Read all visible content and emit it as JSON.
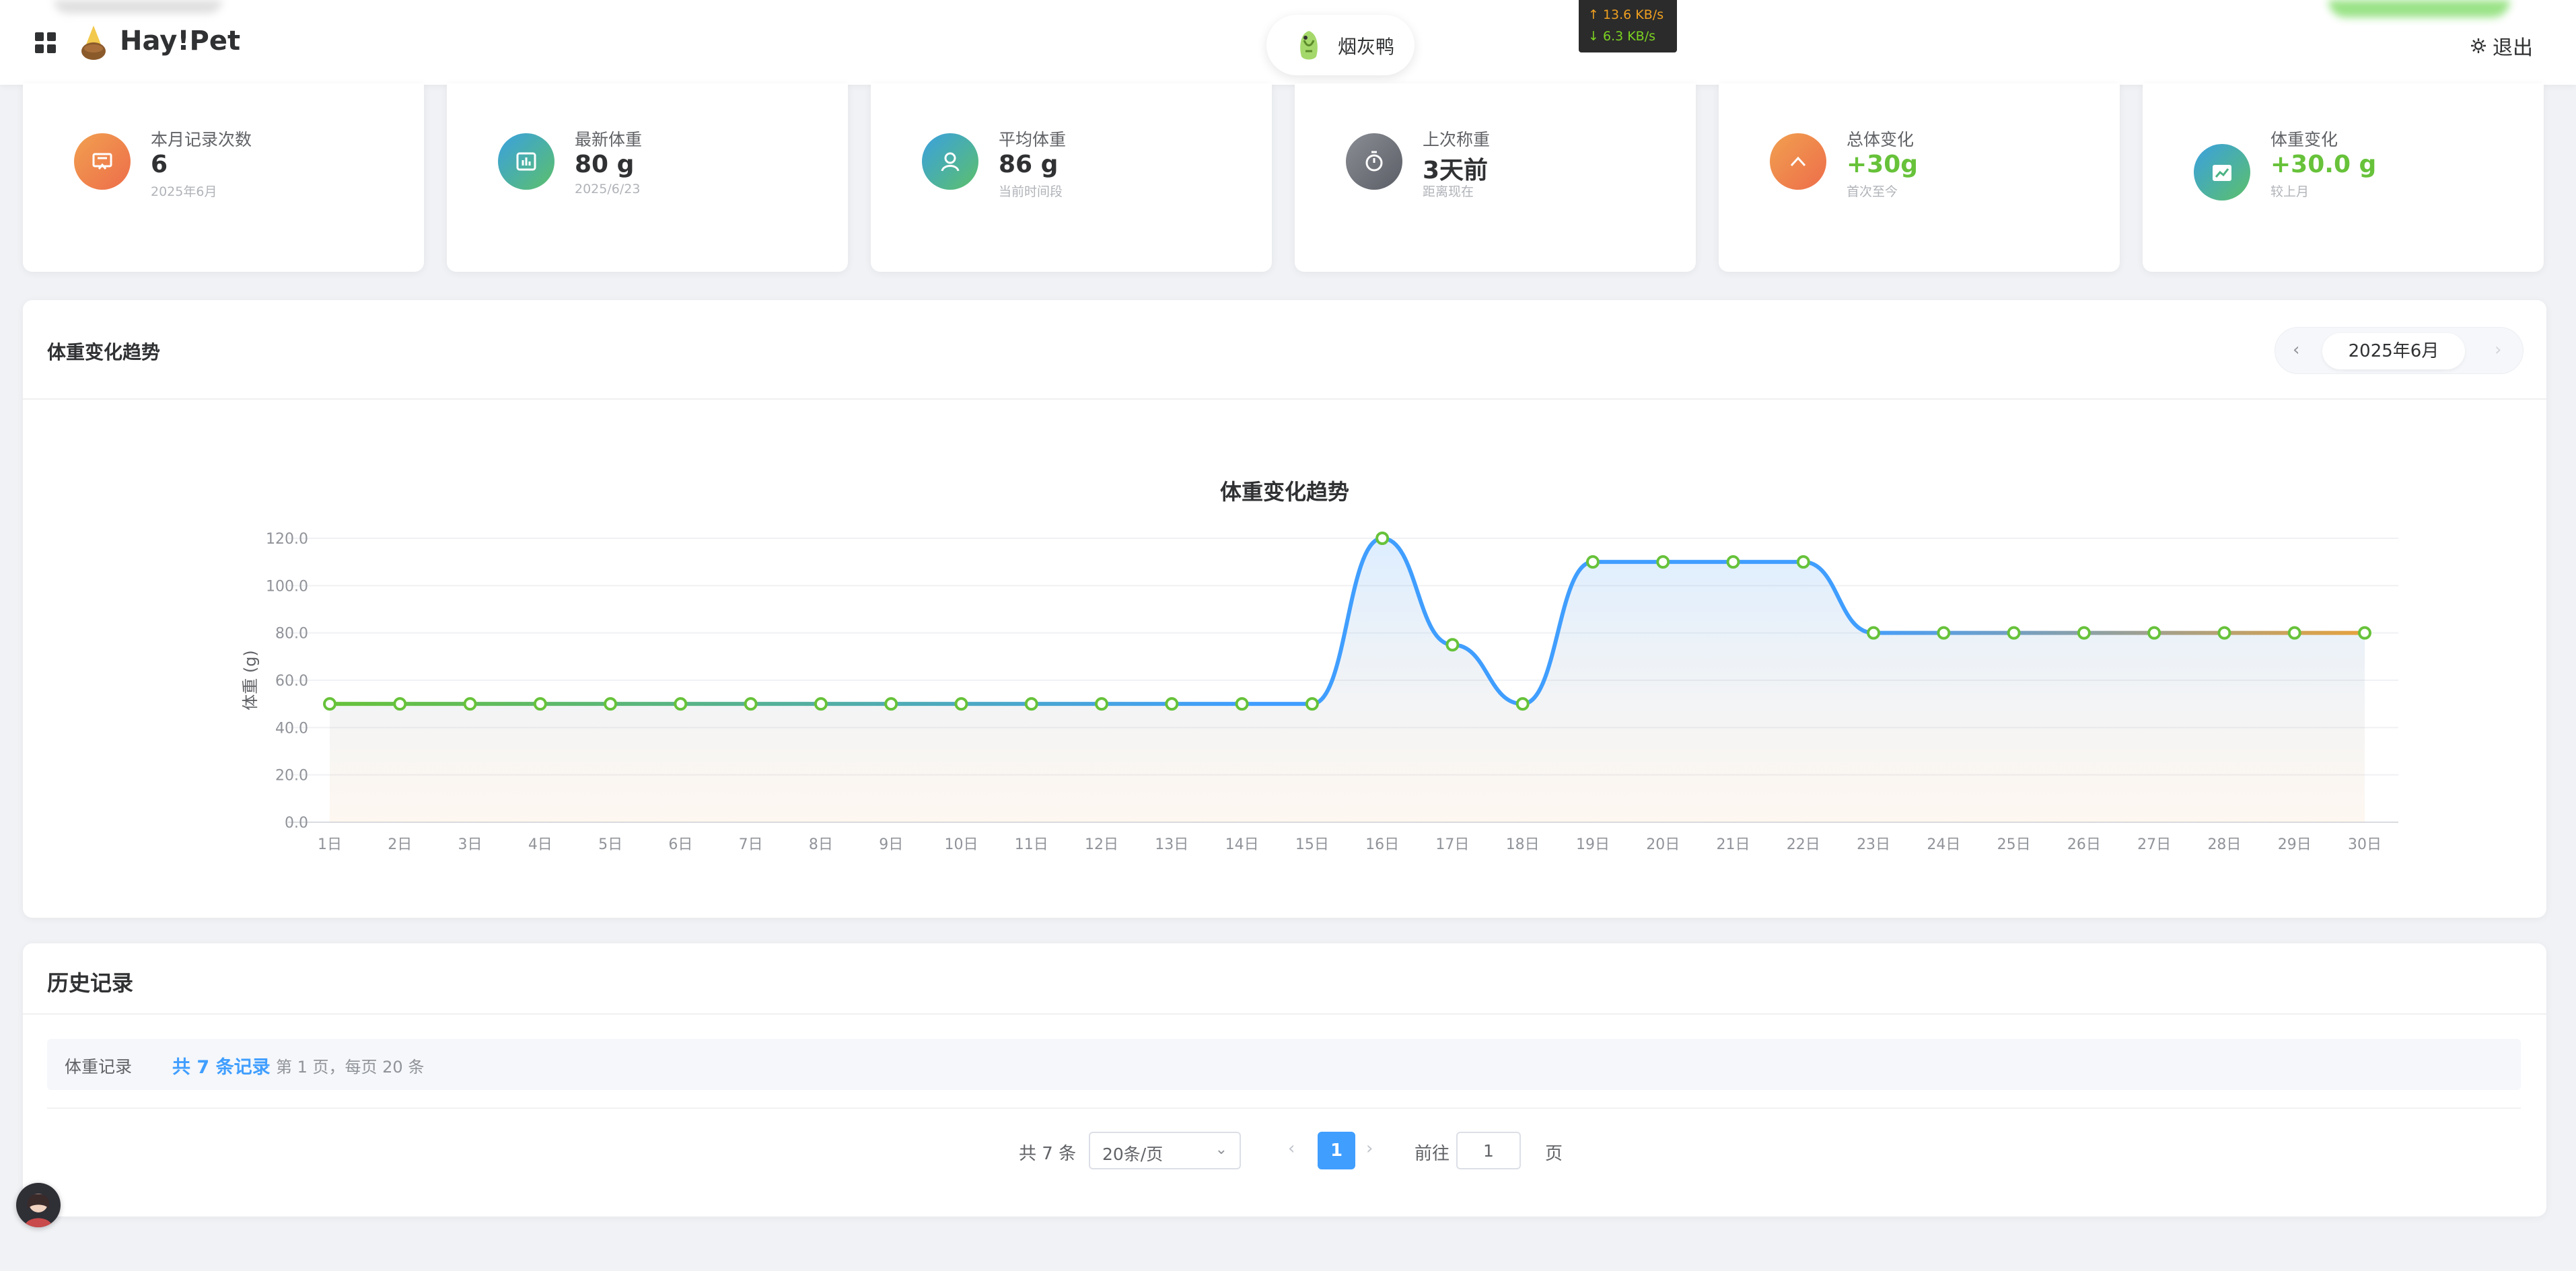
{
  "header": {
    "brand": "Hay!Pet",
    "pet_name": "烟灰鸭",
    "logout_label": "退出",
    "net_up": "↑ 13.6 KB/s",
    "net_down": "↓ 6.3 KB/s"
  },
  "stats": [
    {
      "label": "本月记录次数",
      "value": "6",
      "sub": "2025年6月",
      "icon": "presentation-icon",
      "color_from": "#f0a050",
      "color_to": "#ee6d4a"
    },
    {
      "label": "最新体重",
      "value": "80 g",
      "sub": "2025/6/23",
      "icon": "bar-chart-icon",
      "color_from": "#3aa0e0",
      "color_to": "#5cc06a"
    },
    {
      "label": "平均体重",
      "value": "86 g",
      "sub": "当前时间段",
      "icon": "user-icon",
      "color_from": "#3aa0e0",
      "color_to": "#5cc06a"
    },
    {
      "label": "上次称重",
      "value": "3天前",
      "sub": "距离现在",
      "icon": "stopwatch-icon",
      "color_from": "#8a8d94",
      "color_to": "#5b5e66"
    },
    {
      "label": "总体变化",
      "value": "+30g",
      "sub": "首次至今",
      "icon": "arrow-up-icon",
      "color_from": "#f0a050",
      "color_to": "#ee6d4a"
    },
    {
      "label": "体重变化",
      "value": "+30.0 g",
      "sub": "较上月",
      "icon": "trend-chart-icon",
      "color_from": "#3aa0e0",
      "color_to": "#5cc06a"
    }
  ],
  "chart_panel": {
    "title": "体重变化趋势",
    "month_label": "2025年6月",
    "prev_label": "‹",
    "next_label": "›"
  },
  "chart_data": {
    "type": "line",
    "title": "体重变化趋势",
    "xlabel": "",
    "ylabel": "体重 (g)",
    "ylim": [
      0,
      120
    ],
    "yticks": [
      "0.0",
      "20.0",
      "40.0",
      "60.0",
      "80.0",
      "100.0",
      "120.0"
    ],
    "categories": [
      "1日",
      "2日",
      "3日",
      "4日",
      "5日",
      "6日",
      "7日",
      "8日",
      "9日",
      "10日",
      "11日",
      "12日",
      "13日",
      "14日",
      "15日",
      "16日",
      "17日",
      "18日",
      "19日",
      "20日",
      "21日",
      "22日",
      "23日",
      "24日",
      "25日",
      "26日",
      "27日",
      "28日",
      "29日",
      "30日"
    ],
    "values": [
      50,
      50,
      50,
      50,
      50,
      50,
      50,
      50,
      50,
      50,
      50,
      50,
      50,
      50,
      50,
      120,
      75,
      50,
      110,
      110,
      110,
      110,
      80,
      80,
      80,
      80,
      80,
      80,
      80,
      80
    ],
    "smooth": true,
    "area_fill": true,
    "grid": true,
    "colors": {
      "line_start": "#67c23a",
      "line_mid": "#409eff",
      "line_end": "#e6a23c",
      "point": "#67c23a"
    }
  },
  "history": {
    "title": "历史记录",
    "bar_label": "体重记录",
    "bar_count": "共 7 条记录",
    "bar_page": "第 1 页，每页 20 条"
  },
  "pagination": {
    "total": "共 7 条",
    "page_size": "20条/页",
    "current": "1",
    "goto_label": "前往",
    "goto_value": "1",
    "page_suffix": "页"
  }
}
